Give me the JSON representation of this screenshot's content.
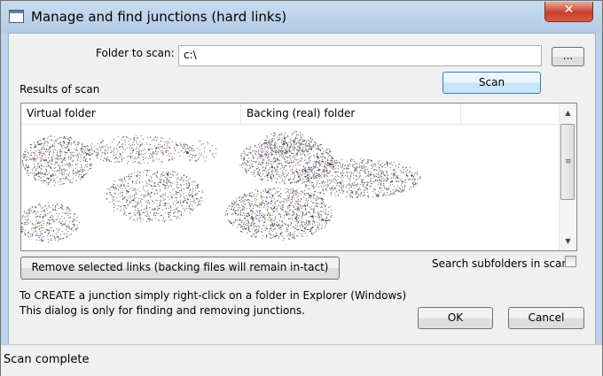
{
  "window": {
    "title": "Manage and find junctions (hard links)",
    "close_glyph": "✕"
  },
  "form": {
    "folder_label": "Folder to scan:",
    "folder_value": "c:\\",
    "browse_label": "...",
    "scan_label": "Scan",
    "results_label": "Results of scan"
  },
  "results": {
    "columns": [
      "Virtual folder",
      "Backing (real) folder"
    ],
    "scroll_up_glyph": "▲",
    "scroll_down_glyph": "▼",
    "scroll_grip_glyph": "≡"
  },
  "actions": {
    "remove_label": "Remove selected links (backing files will remain in-tact)",
    "subfolders_label": "Search subfolders in scan",
    "subfolders_checked": false
  },
  "info": {
    "line1": "To CREATE a junction simply right-click on a folder in Explorer (Windows)",
    "line2": "This dialog is only for finding and removing junctions."
  },
  "buttons": {
    "ok": "OK",
    "cancel": "Cancel"
  },
  "status": {
    "text": "Scan complete"
  }
}
